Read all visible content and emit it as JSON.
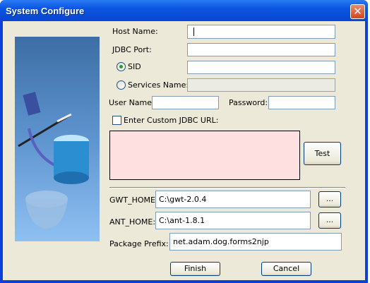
{
  "window": {
    "title": "System Configure",
    "close_icon": "close-icon"
  },
  "form": {
    "host_name_label": "Host Name:",
    "host_name_value": "",
    "jdbc_port_label": "JDBC Port:",
    "jdbc_port_value": "",
    "sid_label": "SID",
    "sid_selected": true,
    "sid_value": "",
    "services_name_label": "Services Name:",
    "services_name_selected": false,
    "services_name_value": "",
    "user_name_label": "User Name:",
    "user_name_value": "",
    "password_label": "Password:",
    "password_value": "",
    "custom_url_label": "Enter Custom JDBC URL:",
    "custom_url_checked": false,
    "test_label": "Test",
    "gwt_home_label": "GWT_HOME:",
    "gwt_home_value": "C:\\gwt-2.0.4",
    "ant_home_label": "ANT_HOME:",
    "ant_home_value": "C:\\ant-1.8.1",
    "browse_label": "...",
    "package_prefix_label": "Package Prefix:",
    "package_prefix_value": "net.adam.dog.forms2njp"
  },
  "buttons": {
    "finish": "Finish",
    "cancel": "Cancel"
  },
  "colors": {
    "title_bar": "#0a55e0",
    "dialog_bg": "#ece9d8",
    "url_area_bg": "#ffe0e0"
  }
}
